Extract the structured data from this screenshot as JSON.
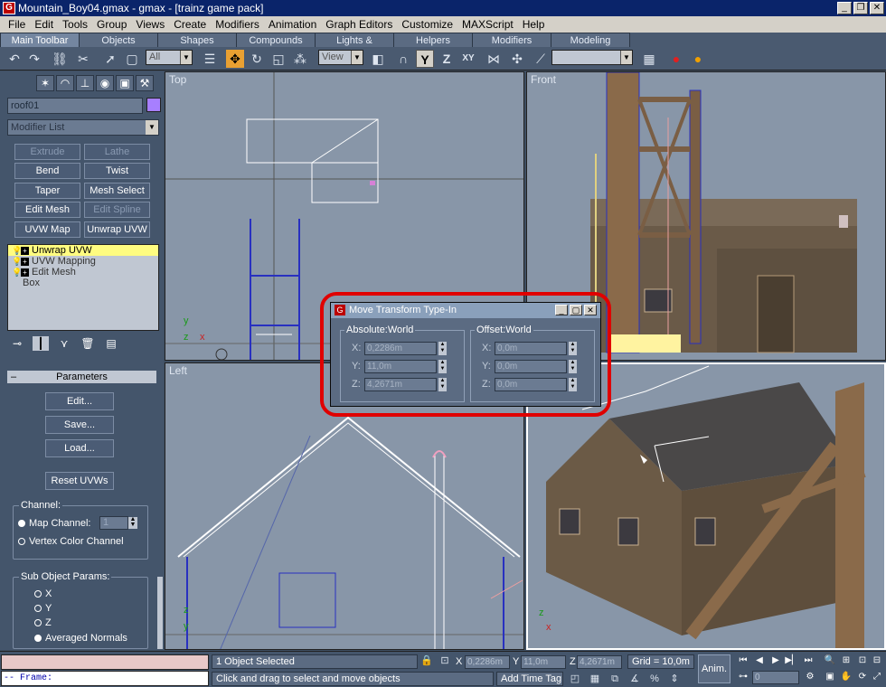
{
  "window": {
    "title": "Mountain_Boy04.gmax - gmax - [trainz game pack]",
    "icon": "gmax-app-icon"
  },
  "menu": [
    "File",
    "Edit",
    "Tools",
    "Group",
    "Views",
    "Create",
    "Modifiers",
    "Animation",
    "Graph Editors",
    "Customize",
    "MAXScript",
    "Help"
  ],
  "tabs": [
    "Main Toolbar",
    "Objects",
    "Shapes",
    "Compounds",
    "Lights & Cameras",
    "Helpers",
    "Modifiers",
    "Modeling"
  ],
  "toolbar": {
    "selection_filter": "All",
    "ref_coord": "View",
    "named_selection": ""
  },
  "command_panel": {
    "object_name": "roof01",
    "object_color": "#a77fff",
    "modifier_list": "Modifier List",
    "modifier_buttons": [
      {
        "label": "Extrude",
        "enabled": false
      },
      {
        "label": "Lathe",
        "enabled": false
      },
      {
        "label": "Bend",
        "enabled": true
      },
      {
        "label": "Twist",
        "enabled": true
      },
      {
        "label": "Taper",
        "enabled": true
      },
      {
        "label": "Mesh Select",
        "enabled": true
      },
      {
        "label": "Edit Mesh",
        "enabled": true
      },
      {
        "label": "Edit Spline",
        "enabled": false
      },
      {
        "label": "UVW Map",
        "enabled": true
      },
      {
        "label": "Unwrap UVW",
        "enabled": true
      }
    ],
    "stack": [
      {
        "label": "Unwrap UVW",
        "selected": true
      },
      {
        "label": "UVW Mapping",
        "selected": false
      },
      {
        "label": "Edit Mesh",
        "selected": false
      },
      {
        "label": "Box",
        "selected": false
      }
    ],
    "parameters": {
      "title": "Parameters",
      "buttons": [
        "Edit...",
        "Save...",
        "Load...",
        "Reset UVWs"
      ],
      "channel_caption": "Channel:",
      "map_channel_label": "Map Channel:",
      "map_channel_value": "1",
      "vertex_color_label": "Vertex Color Channel",
      "sub_object_caption": "Sub Object Params:",
      "axes": [
        "X",
        "Y",
        "Z"
      ],
      "averaged_normals": "Averaged Normals"
    }
  },
  "viewports": {
    "top": "Top",
    "front": "Front",
    "left": "Left",
    "perspective": ""
  },
  "dialog": {
    "title": "Move Transform Type-In",
    "absolute_caption": "Absolute:World",
    "offset_caption": "Offset:World",
    "absolute": [
      {
        "axis": "X:",
        "value": "0,2286m"
      },
      {
        "axis": "Y:",
        "value": "11,0m"
      },
      {
        "axis": "Z:",
        "value": "4,2671m"
      }
    ],
    "offset": [
      {
        "axis": "X:",
        "value": "0,0m"
      },
      {
        "axis": "Y:",
        "value": "0,0m"
      },
      {
        "axis": "Z:",
        "value": "0,0m"
      }
    ]
  },
  "status": {
    "frame_label": "-- Frame:",
    "selection": "1 Object Selected",
    "prompt": "Click and drag to select and move objects",
    "x_label": "X",
    "x": "0,2286m",
    "y_label": "Y",
    "y": "11,0m",
    "z_label": "Z",
    "z": "4,2671m",
    "grid": "Grid = 10,0m",
    "add_time_tag": "Add Time Tag",
    "anim": "Anim.",
    "frame": "0"
  },
  "colors": {
    "accent": "#e9a032",
    "highlight_ring": "#e00000",
    "selected_stack": "#fffc80",
    "panel": "#44556b"
  }
}
